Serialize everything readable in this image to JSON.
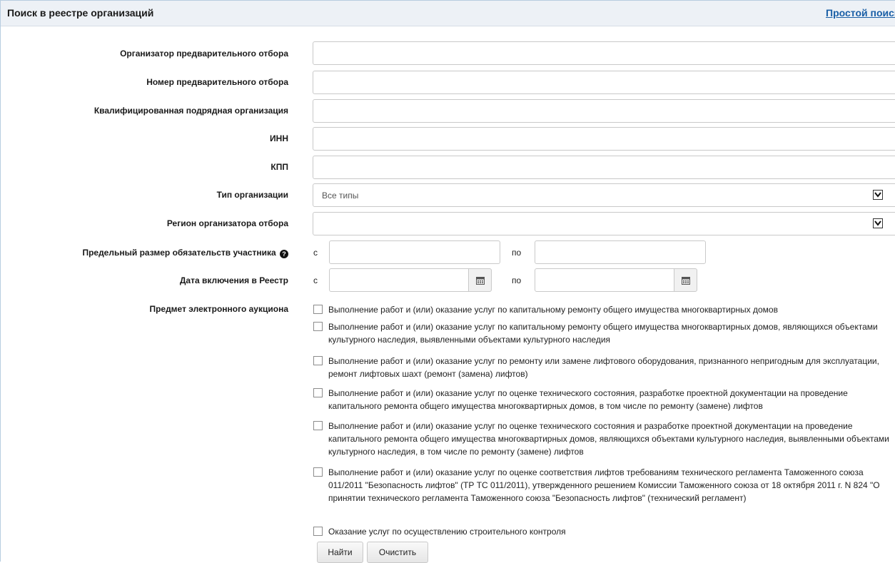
{
  "header": {
    "title": "Поиск в реестре организаций",
    "simple_search_link": "Простой поиск"
  },
  "fields": {
    "organizer": {
      "label": "Организатор предварительного отбора",
      "value": ""
    },
    "number": {
      "label": "Номер предварительного отбора",
      "value": ""
    },
    "contractor": {
      "label": "Квалифицированная подрядная организация",
      "value": ""
    },
    "inn": {
      "label": "ИНН",
      "value": ""
    },
    "kpp": {
      "label": "КПП",
      "value": ""
    },
    "org_type": {
      "label": "Тип организации",
      "selected": "Все типы"
    },
    "region": {
      "label": "Регион организатора отбора",
      "selected": ""
    },
    "liability": {
      "label": "Предельный размер обязательств участника",
      "from": "с",
      "to": "по"
    },
    "date": {
      "label": "Дата включения в Реестр",
      "from": "с",
      "to": "по"
    }
  },
  "subject": {
    "label": "Предмет электронного аукциона",
    "options": [
      {
        "text": "Выполнение работ и (или) оказание услуг по капитальному ремонту общего имущества многоквартирных домов",
        "checked": false
      },
      {
        "text": "Выполнение работ и (или) оказание услуг по капитальному ремонту общего имущества многоквартирных домов, являющихся объектами культурного наследия, выявленными объектами культурного наследия",
        "checked": false
      },
      {
        "text": "Выполнение работ и (или) оказание услуг по ремонту или замене лифтового оборудования, признанного непригодным для эксплуатации, ремонт лифтовых шахт (ремонт (замена) лифтов)",
        "checked": false
      },
      {
        "text": "Выполнение работ и (или) оказание услуг по оценке технического состояния, разработке проектной документации на проведение капитального ремонта общего имущества многоквартирных домов, в том числе по ремонту (замене) лифтов",
        "checked": false
      },
      {
        "text": "Выполнение работ и (или) оказание услуг по оценке технического состояния и разработке проектной документации на проведение капитального ремонта общего имущества многоквартирных домов, являющихся объектами культурного наследия, выявленными объектами культурного наследия, в том числе по ремонту (замене) лифтов",
        "checked": false
      },
      {
        "text": "Выполнение работ и (или) оказание услуг по оценке соответствия лифтов требованиям технического регламента Таможенного союза 011/2011 \"Безопасность лифтов\" (ТР ТС 011/2011), утвержденного решением Комиссии Таможенного союза от 18 октября 2011 г. N 824 \"О принятии технического регламента Таможенного союза \"Безопасность лифтов\" (технический регламент)",
        "checked": false
      },
      {
        "text": "Оказание услуг по осуществлению строительного контроля",
        "checked": false
      }
    ]
  },
  "buttons": {
    "find": "Найти",
    "clear": "Очистить"
  },
  "icons": {
    "help": "question-circle-icon",
    "calendar": "calendar-icon",
    "dropdown": "chevron-down-icon"
  },
  "colors": {
    "header_bg": "#edf1f6",
    "link": "#1a5fa6",
    "border": "#c9c9c9"
  }
}
